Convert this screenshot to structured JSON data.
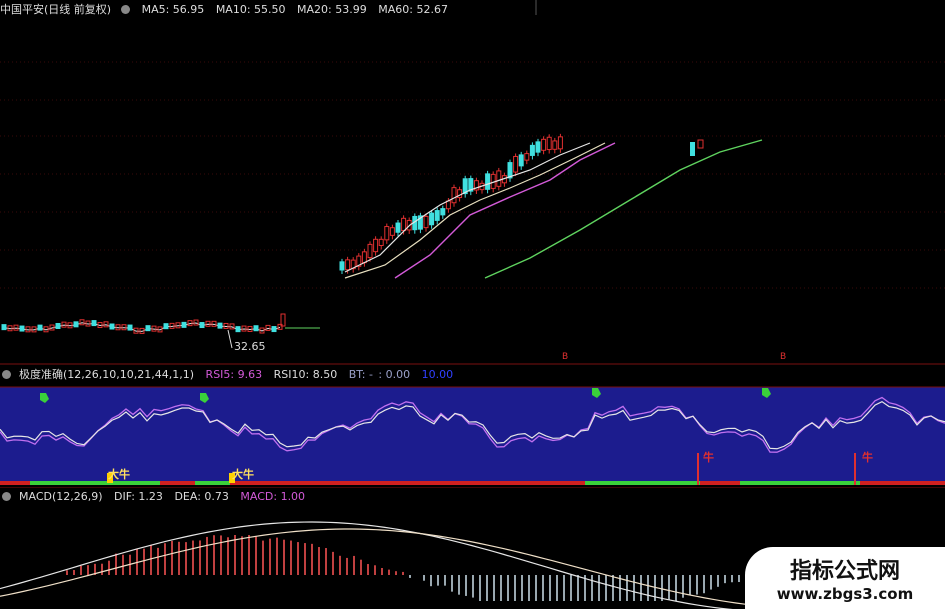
{
  "main": {
    "title": "中国平安(日线 前复权)",
    "ma": [
      {
        "label": "MA5: 56.95",
        "color": "#e6e6e6"
      },
      {
        "label": "MA10: 55.50",
        "color": "#e6e6e6"
      },
      {
        "label": "MA20: 53.99",
        "color": "#d35ad8"
      },
      {
        "label": "MA60: 52.67",
        "color": "#5fd35f"
      }
    ],
    "low_label": "32.65",
    "bar_markers": [
      "B",
      "B"
    ]
  },
  "rsi": {
    "title": "极度准确(12,26,10,10,21,44,1,1)",
    "items": [
      {
        "label": "RSI5: 9.63",
        "color": "#d35ad8"
      },
      {
        "label": "RSI10: 8.50",
        "color": "#e6e6e6"
      },
      {
        "label": "BT: -",
        "color": "#9aa0c8"
      },
      {
        "label": ": 0.00",
        "color": "#9aa0c8"
      },
      {
        "label": "10.00",
        "color": "#3040ff"
      }
    ],
    "signals": [
      "大牛",
      "大牛",
      "牛",
      "牛"
    ]
  },
  "macd": {
    "title": "MACD(12,26,9)",
    "items": [
      {
        "label": "DIF: 1.23",
        "color": "#e6e6e6"
      },
      {
        "label": "DEA: 0.73",
        "color": "#e6e6e6"
      },
      {
        "label": "MACD: 1.00",
        "color": "#d35ad8"
      }
    ]
  },
  "colors": {
    "up": "#e03030",
    "down": "#40e0e0",
    "ma60": "#5fd35f",
    "ma20": "#d35ad8",
    "band": "#1c1c8e",
    "separator": "#7a0f0f"
  },
  "watermark": {
    "title": "指标公式网",
    "url": "www.zbgs3.com"
  }
}
